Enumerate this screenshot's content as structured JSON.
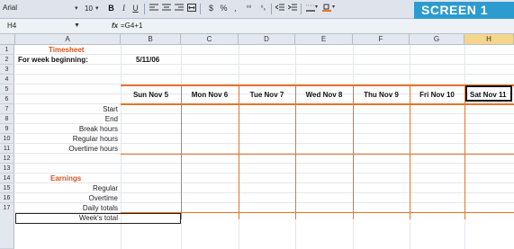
{
  "toolbar": {
    "font_name": "Arial",
    "font_size": "10",
    "bold": "B",
    "italic": "I",
    "underline": "U",
    "badge": "SCREEN 1"
  },
  "formula_bar": {
    "name_box": "H4",
    "fx": "fx",
    "formula": "=G4+1"
  },
  "columns": [
    "A",
    "B",
    "C",
    "D",
    "E",
    "F",
    "G",
    "H"
  ],
  "rows": [
    "1",
    "2",
    "3",
    "4",
    "5",
    "6",
    "7",
    "8",
    "9",
    "10",
    "11",
    "12",
    "13",
    "14",
    "15",
    "16",
    "17"
  ],
  "sheet": {
    "title": "Timesheet",
    "week_label": "For week beginning:",
    "week_value": "5/11/06",
    "days": [
      "Sun Nov 5",
      "Mon Nov 6",
      "Tue Nov 7",
      "Wed Nov 8",
      "Thu Nov 9",
      "Fri Nov 10",
      "Sat Nov 11"
    ],
    "row_labels": [
      "Start",
      "End",
      "Break hours",
      "Regular hours",
      "Overtime hours"
    ],
    "earnings_title": "Earnings",
    "earnings_labels": [
      "Regular",
      "Overtime",
      "Daily totals",
      "Week's total"
    ]
  },
  "colors": {
    "accent_orange": "#e8732a",
    "title_orange": "#d9531e",
    "badge_blue": "#2c9bd0",
    "selected_header": "#f4d58b"
  }
}
